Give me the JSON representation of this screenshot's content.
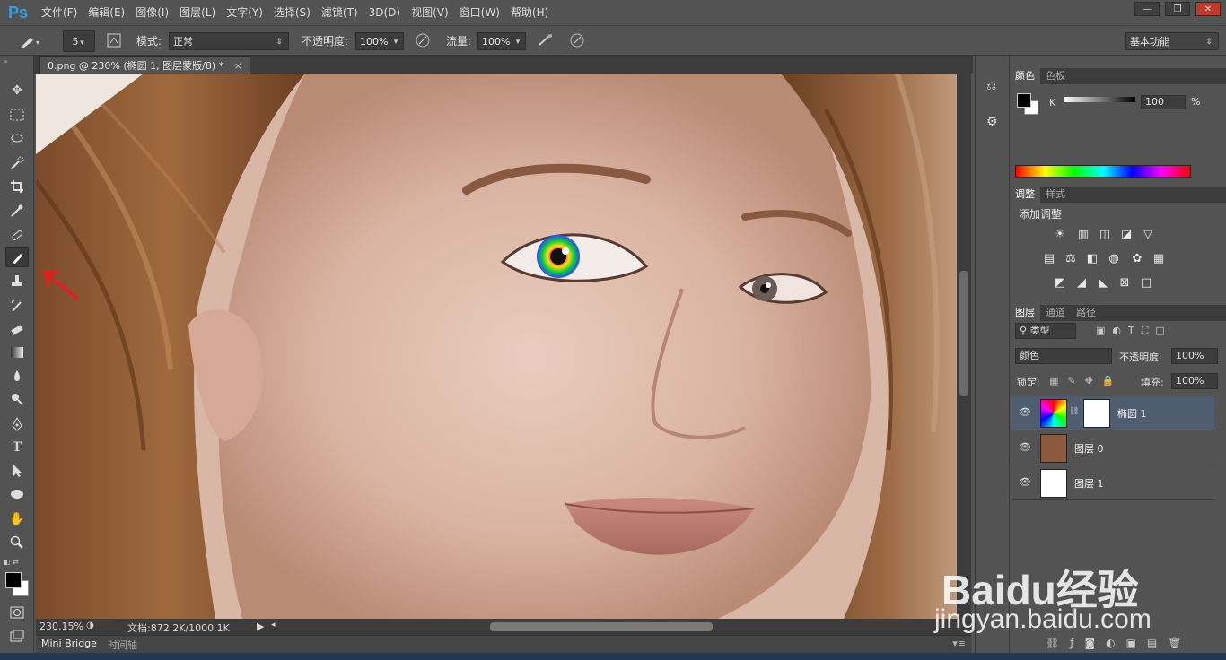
{
  "app": {
    "logo": "Ps"
  },
  "menu": [
    "文件(F)",
    "编辑(E)",
    "图像(I)",
    "图层(L)",
    "文字(Y)",
    "选择(S)",
    "滤镜(T)",
    "3D(D)",
    "视图(V)",
    "窗口(W)",
    "帮助(H)"
  ],
  "window_controls": {
    "min": "—",
    "restore": "❐",
    "close": "✕"
  },
  "options": {
    "brush_size": "5",
    "mode_label": "模式:",
    "mode_value": "正常",
    "opacity_label": "不透明度:",
    "opacity_value": "100%",
    "flow_label": "流量:",
    "flow_value": "100%",
    "workspace": "基本功能"
  },
  "document": {
    "tab_title": "0.png @ 230% (椭圆 1, 图层蒙版/8) *",
    "zoom": "230.15%",
    "doc_info": "文档:872.2K/1000.1K"
  },
  "bridge": {
    "mini_bridge": "Mini Bridge",
    "timeline": "时间轴"
  },
  "color_panel": {
    "tabs": [
      "颜色",
      "色板"
    ],
    "channel": "K",
    "value": "100",
    "unit": "%"
  },
  "adjust_panel": {
    "tabs": [
      "调整",
      "样式"
    ],
    "title": "添加调整"
  },
  "layers_panel": {
    "tabs": [
      "图层",
      "通道",
      "路径"
    ],
    "filter": "类型",
    "blend_mode": "颜色",
    "opacity_label": "不透明度:",
    "opacity_value": "100%",
    "lock_label": "锁定:",
    "fill_label": "填充:",
    "fill_value": "100%",
    "layers": [
      {
        "name": "椭圆 1",
        "selected": true
      },
      {
        "name": "图层 0",
        "selected": false
      },
      {
        "name": "图层 1",
        "selected": false
      }
    ]
  },
  "watermark": {
    "brand": "Baidu经验",
    "url": "jingyan.baidu.com"
  },
  "colors": {
    "accent": "#2fa3e7",
    "selected_layer": "#4f5d70",
    "panel": "#535353",
    "dark": "#3c3c3c"
  }
}
